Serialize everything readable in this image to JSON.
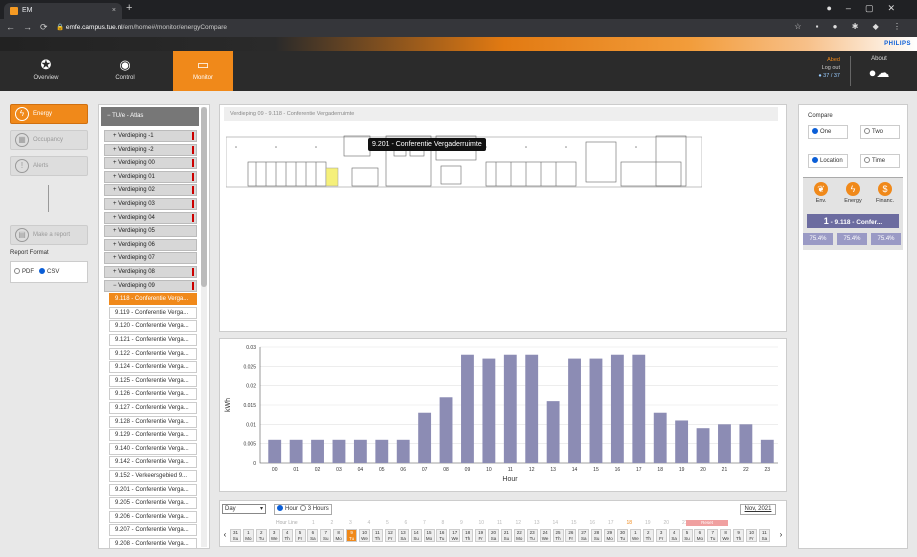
{
  "browser": {
    "tab_title": "EM",
    "url_host": "emfe.campus.tue.nl",
    "url_path": "/em/home#/monitor/energyCompare"
  },
  "brand": "PHILIPS",
  "nav": [
    {
      "label": "Overview",
      "icon": "compass-icon"
    },
    {
      "label": "Control",
      "icon": "eye-icon"
    },
    {
      "label": "Monitor",
      "icon": "monitor-icon",
      "active": true
    }
  ],
  "user": {
    "name": "Abed",
    "logout": "Log out",
    "count": "37 / 37"
  },
  "about": {
    "label": "About"
  },
  "sidebar": {
    "buttons": [
      {
        "label": "Energy",
        "active": true,
        "icon": "lightning-icon"
      },
      {
        "label": "Occupancy",
        "active": false,
        "icon": "building-icon"
      },
      {
        "label": "Alerts",
        "active": false,
        "icon": "warning-icon"
      }
    ],
    "report_button": "Make a report",
    "report_format_label": "Report Format",
    "formats": [
      {
        "label": "PDF",
        "selected": false
      },
      {
        "label": "CSV",
        "selected": true
      }
    ]
  },
  "tree": {
    "root": "TU/e - Atlas",
    "floors": [
      {
        "label": "Verdieping -1",
        "mark": true
      },
      {
        "label": "Verdieping -2",
        "mark": true
      },
      {
        "label": "Verdieping 00",
        "mark": true
      },
      {
        "label": "Verdieping 01",
        "mark": true
      },
      {
        "label": "Verdieping 02",
        "mark": true
      },
      {
        "label": "Verdieping 03",
        "mark": true
      },
      {
        "label": "Verdieping 04",
        "mark": true
      },
      {
        "label": "Verdieping 05",
        "mark": false
      },
      {
        "label": "Verdieping 06",
        "mark": false
      },
      {
        "label": "Verdieping 07",
        "mark": false
      },
      {
        "label": "Verdieping 08",
        "mark": true
      },
      {
        "label": "Verdieping 09",
        "mark": true,
        "expanded": true
      }
    ],
    "rooms": [
      {
        "label": "9.118 - Conferentie Verga...",
        "selected": true
      },
      {
        "label": "9.119 - Conferentie Verga..."
      },
      {
        "label": "9.120 - Conferentie Verga..."
      },
      {
        "label": "9.121 - Conferentie Verga..."
      },
      {
        "label": "9.122 - Conferentie Verga..."
      },
      {
        "label": "9.124 - Conferentie Verga..."
      },
      {
        "label": "9.125 - Conferentie Verga..."
      },
      {
        "label": "9.126 - Conferentie Verga..."
      },
      {
        "label": "9.127 - Conferentie Verga..."
      },
      {
        "label": "9.128 - Conferentie Verga..."
      },
      {
        "label": "9.129 - Conferentie Verga..."
      },
      {
        "label": "9.140 - Conferentie Verga..."
      },
      {
        "label": "9.142 - Conferentie Verga..."
      },
      {
        "label": "9.152 - Verkeersgebied 9..."
      },
      {
        "label": "9.201 - Conferentie Verga..."
      },
      {
        "label": "9.205 - Conferentie Verga..."
      },
      {
        "label": "9.206 - Conferentie Verga..."
      },
      {
        "label": "9.207 - Conferentie Verga..."
      },
      {
        "label": "9.208 - Conferentie Verga..."
      }
    ]
  },
  "plan": {
    "breadcrumb": "Verdieping 09 - 9.118 - Conferentie Vergaderruimte",
    "tooltip": "9.201 - Conferentie Vergaderruimte"
  },
  "chart_data": {
    "type": "bar",
    "categories": [
      "00",
      "01",
      "02",
      "03",
      "04",
      "05",
      "06",
      "07",
      "08",
      "09",
      "10",
      "11",
      "12",
      "13",
      "14",
      "15",
      "16",
      "17",
      "18",
      "19",
      "20",
      "21",
      "22",
      "23"
    ],
    "values": [
      0.006,
      0.006,
      0.006,
      0.006,
      0.006,
      0.006,
      0.006,
      0.013,
      0.017,
      0.028,
      0.027,
      0.028,
      0.028,
      0.016,
      0.027,
      0.027,
      0.028,
      0.028,
      0.013,
      0.011,
      0.009,
      0.01,
      0.01,
      0.006
    ],
    "xlabel": "Hour",
    "ylabel": "kWh",
    "ylim": [
      0,
      0.03
    ],
    "yticks": [
      "0",
      "0.005",
      "0.01",
      "0.015",
      "0.02",
      "0.025",
      "0.03"
    ],
    "grid": true,
    "bar_color": "#8c8cb4"
  },
  "timeline": {
    "period": "Day",
    "hour_option": "Hour",
    "three_hours_option": "3 Hours",
    "date": "Nov, 2021",
    "hour_line": "Hour Line",
    "reset": "Reset",
    "days": [
      "31",
      "1",
      "2",
      "3",
      "4",
      "5",
      "6",
      "7",
      "8",
      "9",
      "10",
      "11",
      "12",
      "13",
      "14",
      "15",
      "16",
      "17",
      "18",
      "19",
      "20",
      "21",
      "22",
      "23",
      "24",
      "25",
      "26",
      "27",
      "28",
      "29",
      "30",
      "1",
      "2",
      "3",
      "4",
      "5",
      "6",
      "7",
      "8",
      "9",
      "10",
      "11"
    ],
    "weekdays": [
      "Su",
      "Mo",
      "Tu",
      "We",
      "Th",
      "Fr",
      "Sa",
      "Su",
      "Mo",
      "Tu",
      "We",
      "Th",
      "Fr",
      "Sa",
      "Su",
      "Mo",
      "Tu",
      "We",
      "Th",
      "Fr",
      "Sa",
      "Su",
      "Mo",
      "Tu",
      "We",
      "Th",
      "Fr",
      "Sa",
      "Su",
      "Mo",
      "Tu",
      "We",
      "Th",
      "Fr",
      "Sa",
      "Su",
      "Mo",
      "Tu",
      "We",
      "Th",
      "Fr",
      "Sa"
    ],
    "selected_index": 9,
    "hours": [
      "1",
      "2",
      "3",
      "4",
      "5",
      "6",
      "7",
      "8",
      "9",
      "10",
      "11",
      "12",
      "13",
      "14",
      "15",
      "16",
      "17",
      "18",
      "19",
      "20",
      "21",
      "22",
      "23"
    ]
  },
  "compare": {
    "title": "Compare",
    "count_options": [
      {
        "label": "One",
        "selected": true
      },
      {
        "label": "Two",
        "selected": false
      }
    ],
    "mode_options": [
      {
        "label": "Location",
        "selected": true
      },
      {
        "label": "Time",
        "selected": false
      }
    ],
    "icons": [
      {
        "label": "Env.",
        "icon": "leaf-icon"
      },
      {
        "label": "Energy",
        "icon": "lightning-icon"
      },
      {
        "label": "Financ.",
        "icon": "money-icon"
      }
    ],
    "index": "1",
    "room": "- 9.118 - Confer...",
    "percents": [
      "75.4%",
      "75.4%",
      "75.4%"
    ]
  }
}
